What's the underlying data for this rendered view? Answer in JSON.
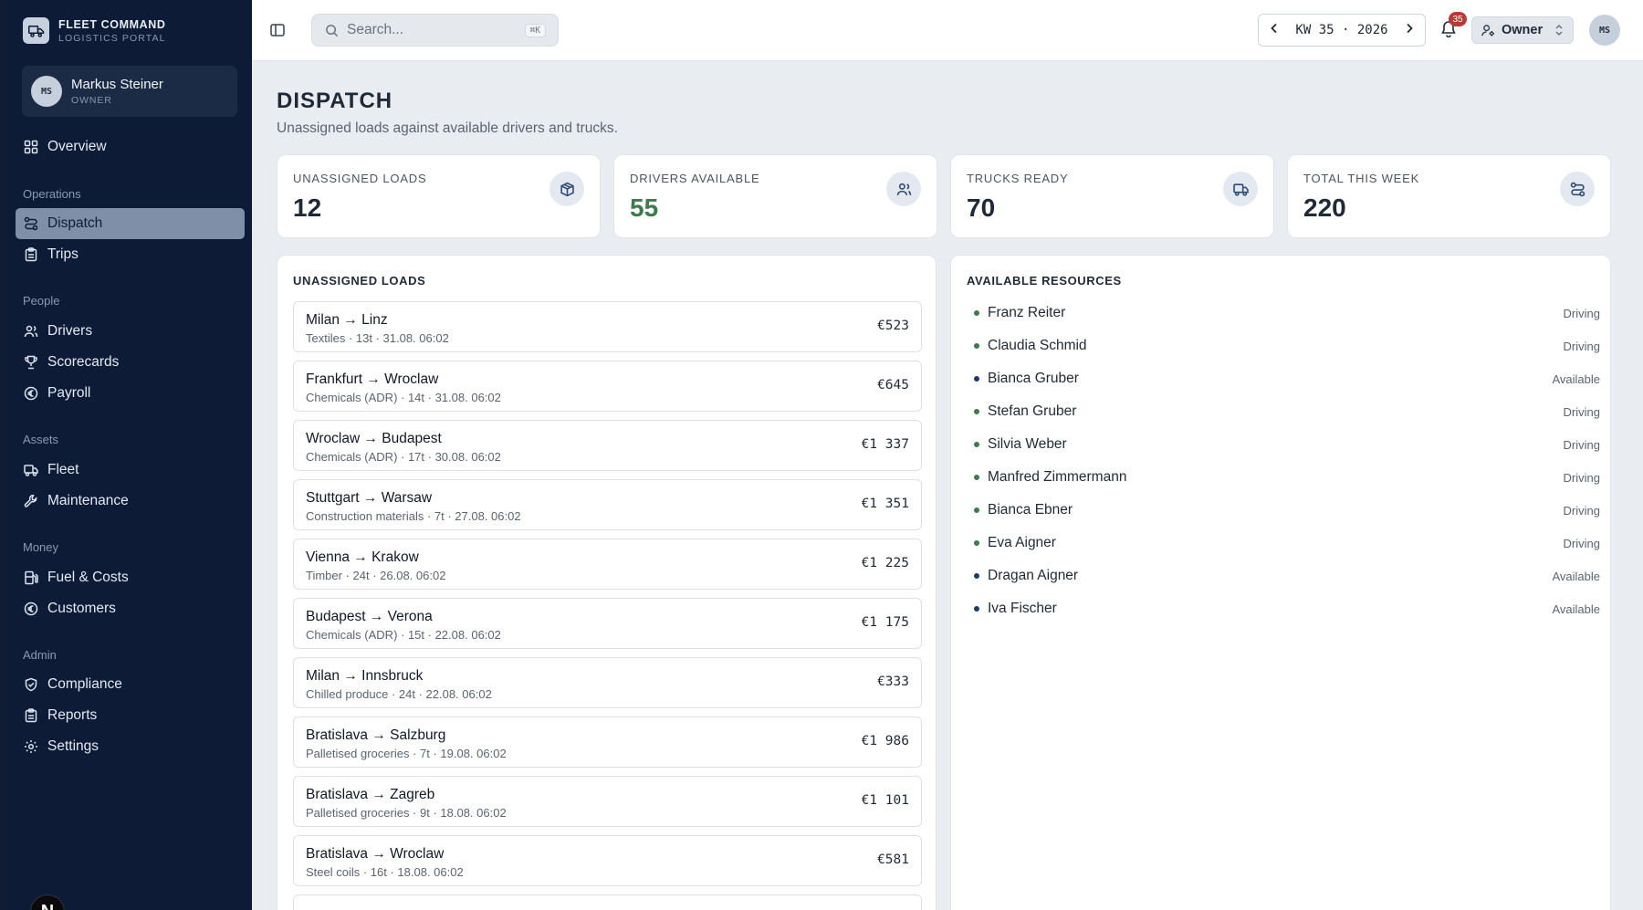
{
  "brand": {
    "title": "FLEET COMMAND",
    "subtitle": "LOGISTICS PORTAL"
  },
  "user": {
    "initials": "MS",
    "name": "Markus Steiner",
    "role": "OWNER"
  },
  "nav": {
    "overview": "Overview",
    "sections": {
      "operations": "Operations",
      "people": "People",
      "assets": "Assets",
      "money": "Money",
      "admin": "Admin"
    },
    "items": {
      "dispatch": "Dispatch",
      "trips": "Trips",
      "drivers": "Drivers",
      "scorecards": "Scorecards",
      "payroll": "Payroll",
      "fleet": "Fleet",
      "maintenance": "Maintenance",
      "fuel": "Fuel & Costs",
      "customers": "Customers",
      "compliance": "Compliance",
      "reports": "Reports",
      "settings": "Settings"
    },
    "active": "dispatch"
  },
  "n_badge": "N",
  "topbar": {
    "search_placeholder": "Search...",
    "search_shortcut": "⌘K",
    "week_label": "KW 35 · 2026",
    "notifications_count": "35",
    "role_selector": "Owner",
    "avatar_initials": "MS"
  },
  "page": {
    "title": "DISPATCH",
    "subtitle": "Unassigned loads against available drivers and trucks."
  },
  "stats": [
    {
      "label": "UNASSIGNED LOADS",
      "value": "12",
      "icon": "package-icon"
    },
    {
      "label": "DRIVERS AVAILABLE",
      "value": "55",
      "icon": "users-icon"
    },
    {
      "label": "TRUCKS READY",
      "value": "70",
      "icon": "truck-icon"
    },
    {
      "label": "TOTAL THIS WEEK",
      "value": "220",
      "icon": "route-icon"
    }
  ],
  "colors": {
    "accent_green": "#3e7a4c",
    "dot_driving": "#3e7a4c",
    "dot_available": "#1e3a6b",
    "sidebar_bg": "#0d1b36",
    "active_nav": "#7f8fa8"
  },
  "loads_panel": {
    "title": "UNASSIGNED LOADS",
    "loads": [
      {
        "route": "Milan → Linz",
        "meta": "Textiles · 13t · 31.08. 06:02",
        "price": "€523"
      },
      {
        "route": "Frankfurt → Wroclaw",
        "meta": "Chemicals (ADR) · 14t · 31.08. 06:02",
        "price": "€645"
      },
      {
        "route": "Wroclaw → Budapest",
        "meta": "Chemicals (ADR) · 17t · 30.08. 06:02",
        "price": "€1 337"
      },
      {
        "route": "Stuttgart → Warsaw",
        "meta": "Construction materials · 7t · 27.08. 06:02",
        "price": "€1 351"
      },
      {
        "route": "Vienna → Krakow",
        "meta": "Timber · 24t · 26.08. 06:02",
        "price": "€1 225"
      },
      {
        "route": "Budapest → Verona",
        "meta": "Chemicals (ADR) · 15t · 22.08. 06:02",
        "price": "€1 175"
      },
      {
        "route": "Milan → Innsbruck",
        "meta": "Chilled produce · 24t · 22.08. 06:02",
        "price": "€333"
      },
      {
        "route": "Bratislava → Salzburg",
        "meta": "Palletised groceries · 7t · 19.08. 06:02",
        "price": "€1 986"
      },
      {
        "route": "Bratislava → Zagreb",
        "meta": "Palletised groceries · 9t · 18.08. 06:02",
        "price": "€1 101"
      },
      {
        "route": "Bratislava → Wroclaw",
        "meta": "Steel coils · 16t · 18.08. 06:02",
        "price": "€581"
      }
    ]
  },
  "resources_panel": {
    "title": "AVAILABLE RESOURCES",
    "resources": [
      {
        "name": "Franz Reiter",
        "status": "Driving"
      },
      {
        "name": "Claudia Schmid",
        "status": "Driving"
      },
      {
        "name": "Bianca Gruber",
        "status": "Available"
      },
      {
        "name": "Stefan Gruber",
        "status": "Driving"
      },
      {
        "name": "Silvia Weber",
        "status": "Driving"
      },
      {
        "name": "Manfred Zimmermann",
        "status": "Driving"
      },
      {
        "name": "Bianca Ebner",
        "status": "Driving"
      },
      {
        "name": "Eva Aigner",
        "status": "Driving"
      },
      {
        "name": "Dragan Aigner",
        "status": "Available"
      },
      {
        "name": "Iva Fischer",
        "status": "Available"
      }
    ]
  }
}
